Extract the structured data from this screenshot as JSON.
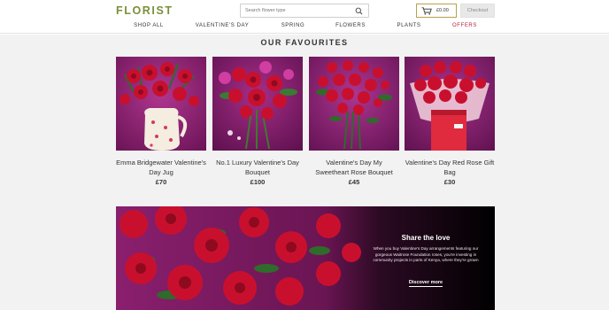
{
  "header": {
    "logo": "FLORIST",
    "search_placeholder": "Search flower type",
    "basket_total": "£0.00",
    "checkout_label": "Checkout"
  },
  "nav": {
    "items": [
      {
        "label": "SHOP ALL"
      },
      {
        "label": "VALENTINE'S DAY"
      },
      {
        "label": "SPRING"
      },
      {
        "label": "FLOWERS"
      },
      {
        "label": "PLANTS"
      },
      {
        "label": "OFFERS"
      }
    ]
  },
  "favourites": {
    "title": "OUR FAVOURITES",
    "products": [
      {
        "name": "Emma Bridgewater Valentine's Day Jug",
        "price": "£70"
      },
      {
        "name": "No.1 Luxury Valentine's Day Bouquet",
        "price": "£100"
      },
      {
        "name": "Valentine's Day My Sweetheart Rose Bouquet",
        "price": "£45"
      },
      {
        "name": "Valentine's Day Red Rose Gift Bag",
        "price": "£30"
      }
    ]
  },
  "banner": {
    "heading": "Share the love",
    "body": "When you buy Valentine's Day arrangements featuring our gorgeous Waitrose Foundation roses, you're investing in community projects in parts of Kenya, where they're grown",
    "link": "Discover more"
  },
  "colors": {
    "brand": "#7a8f3a",
    "offers": "#b0243a",
    "basket_border": "#b8a24a",
    "magenta_bg": "#8a1f6e",
    "rose_red": "#c8102e"
  }
}
